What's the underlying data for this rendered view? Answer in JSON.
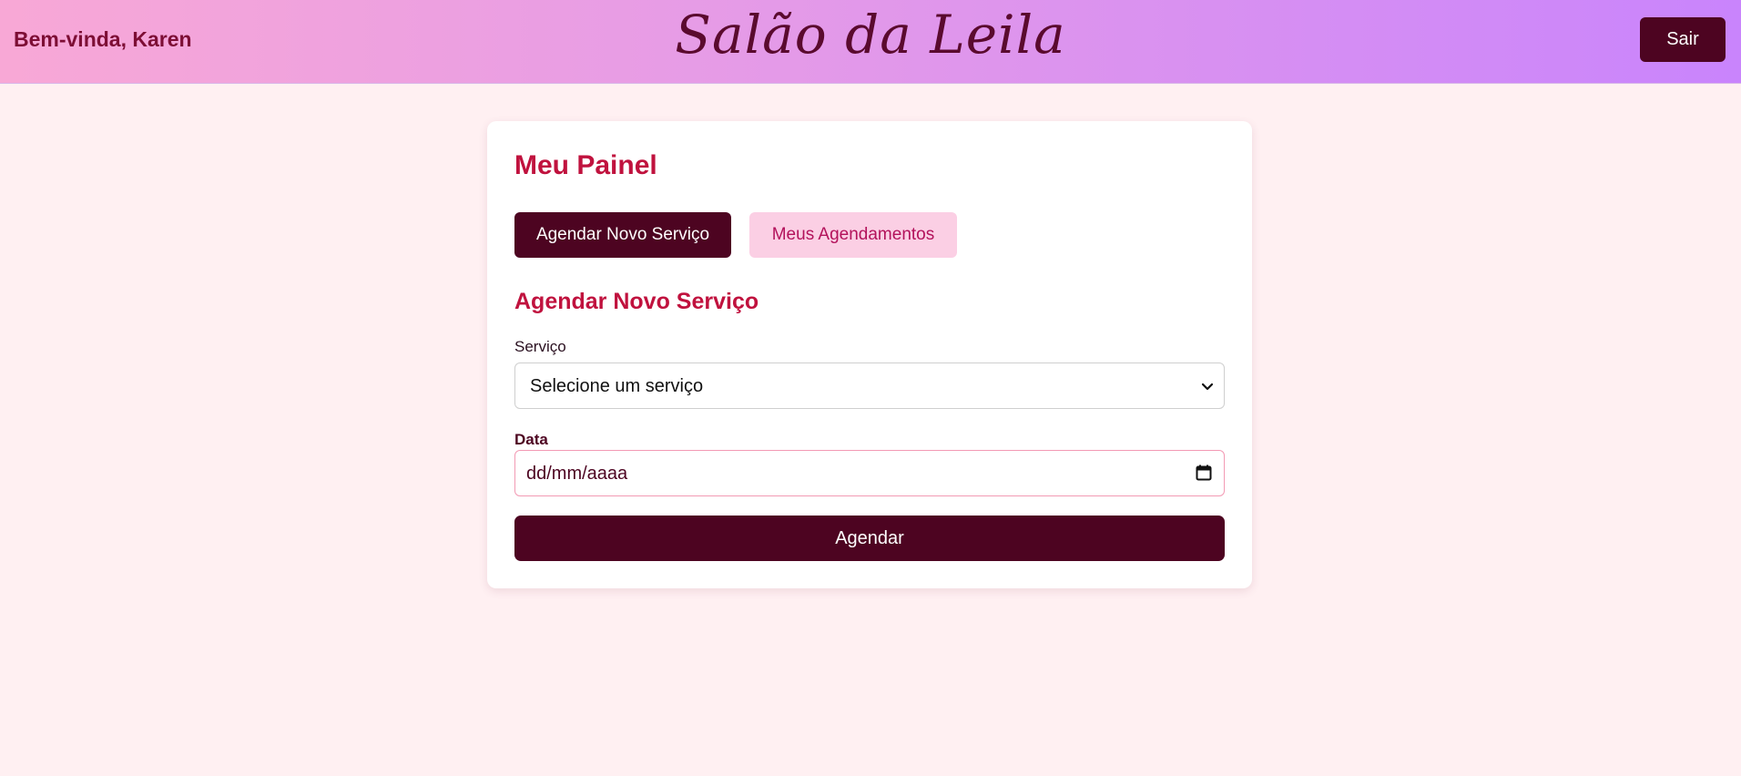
{
  "header": {
    "welcome": "Bem-vinda, Karen",
    "brand": "Salão da Leila",
    "logout_label": "Sair"
  },
  "panel": {
    "title": "Meu Painel",
    "tabs": [
      {
        "label": "Agendar Novo Serviço",
        "active": true
      },
      {
        "label": "Meus Agendamentos",
        "active": false
      }
    ]
  },
  "form": {
    "title": "Agendar Novo Serviço",
    "service_label": "Serviço",
    "service_value": "Selecione um serviço",
    "date_label": "Data",
    "date_placeholder": "dd/mm/aaaa",
    "submit_label": "Agendar"
  },
  "icons": {
    "select_chevron": "chevron-down-icon",
    "date_picker": "calendar-icon"
  },
  "colors": {
    "header_gradient_start": "#f8a8d6",
    "header_gradient_end": "#c984fc",
    "page_background": "#fff0f2",
    "primary_dark": "#4d0421",
    "accent_title": "#c0123e",
    "tab_inactive_background": "#fbcfe4",
    "tab_inactive_text": "#b3125b"
  }
}
